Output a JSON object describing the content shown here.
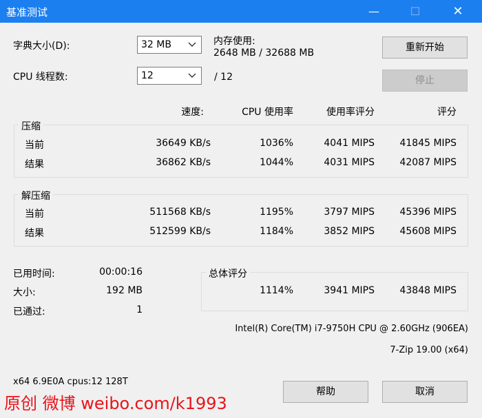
{
  "window": {
    "title": "基准测试",
    "min_glyph": "—",
    "max_glyph": "☐",
    "close_glyph": "✕"
  },
  "dict": {
    "label": "字典大小(D):",
    "value": "32 MB"
  },
  "threads": {
    "label": "CPU 线程数:",
    "value": "12",
    "total": "/ 12"
  },
  "memory": {
    "label": "内存使用:",
    "value": "2648 MB / 32688 MB"
  },
  "buttons": {
    "restart": "重新开始",
    "stop": "停止",
    "help": "帮助",
    "cancel": "取消"
  },
  "columns": {
    "speed": "速度:",
    "cpu_usage": "CPU 使用率",
    "usage_rating": "使用率评分",
    "rating": "评分"
  },
  "compress": {
    "title": "压缩",
    "rows": [
      {
        "label": "当前",
        "speed": "36649 KB/s",
        "usage": "1036%",
        "usage_rating": "4041 MIPS",
        "rating": "41845 MIPS"
      },
      {
        "label": "结果",
        "speed": "36862 KB/s",
        "usage": "1044%",
        "usage_rating": "4031 MIPS",
        "rating": "42087 MIPS"
      }
    ]
  },
  "decompress": {
    "title": "解压缩",
    "rows": [
      {
        "label": "当前",
        "speed": "511568 KB/s",
        "usage": "1195%",
        "usage_rating": "3797 MIPS",
        "rating": "45396 MIPS"
      },
      {
        "label": "结果",
        "speed": "512599 KB/s",
        "usage": "1184%",
        "usage_rating": "3852 MIPS",
        "rating": "45608 MIPS"
      }
    ]
  },
  "stats": {
    "elapsed_label": "已用时间:",
    "elapsed": "00:00:16",
    "size_label": "大小:",
    "size": "192 MB",
    "passes_label": "已通过:",
    "passes": "1"
  },
  "total": {
    "title": "总体评分",
    "usage": "1114%",
    "usage_rating": "3941 MIPS",
    "rating": "43848 MIPS"
  },
  "cpu_info": "Intel(R) Core(TM) i7-9750H CPU @ 2.60GHz (906EA)",
  "version": "7-Zip 19.00 (x64)",
  "sysinfo": "x64 6.9E0A cpus:12 128T",
  "watermark": "原创 微博 weibo.com/k1993",
  "colors": {
    "titlebar": "#1c7ff0",
    "watermark": "#e8141a"
  }
}
